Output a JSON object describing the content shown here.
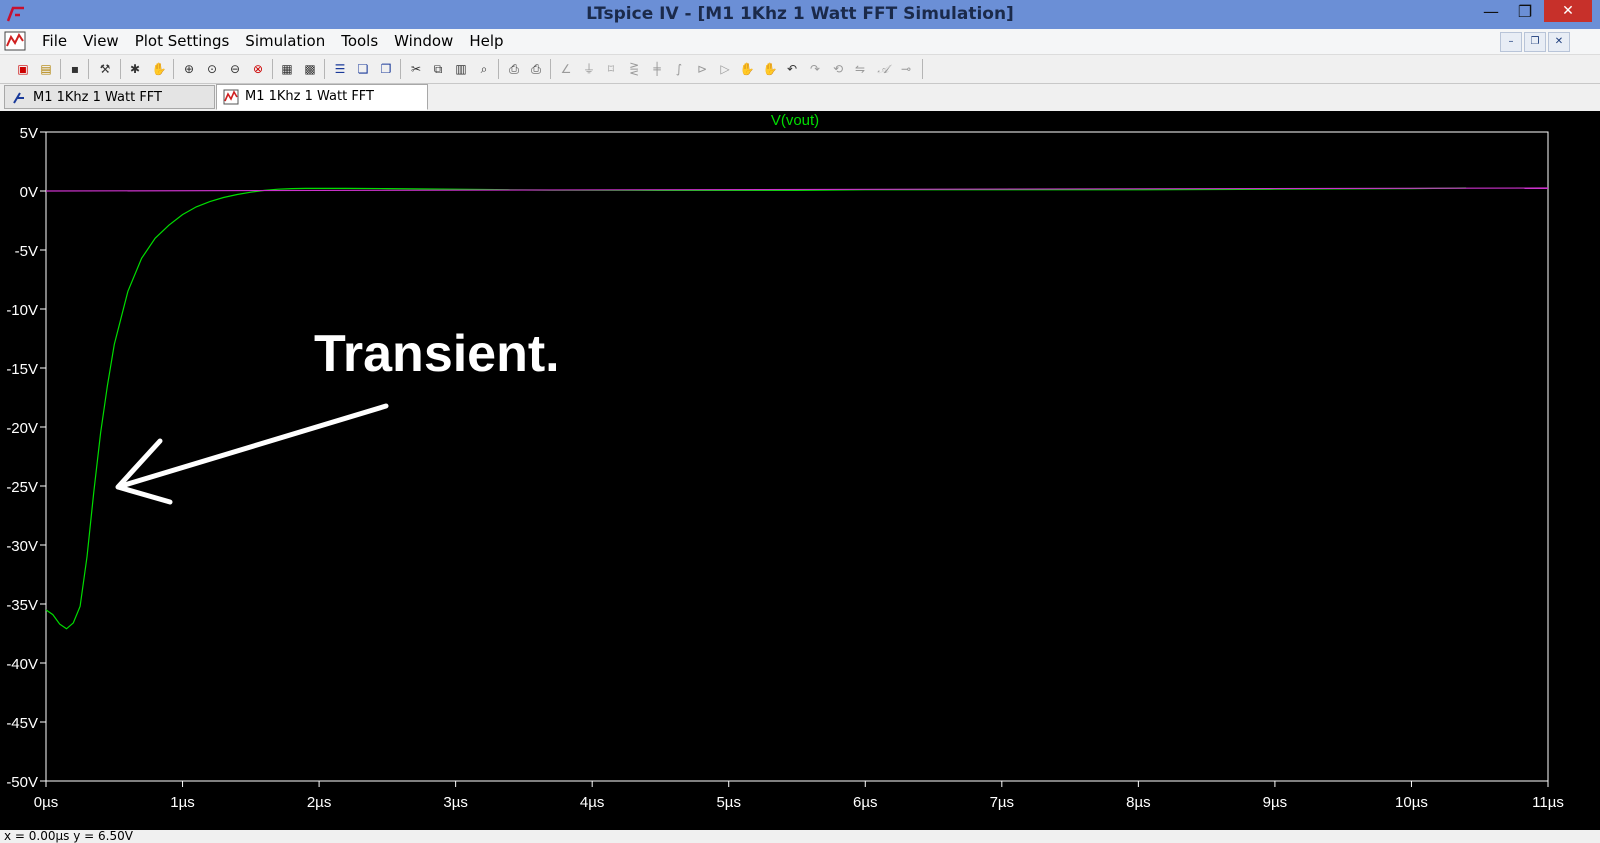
{
  "window": {
    "title": "LTspice IV - [M1 1Khz 1 Watt FFT Simulation]",
    "minimize_glyph": "—",
    "maximize_glyph": "❐",
    "close_glyph": "✕"
  },
  "menu": [
    "File",
    "View",
    "Plot Settings",
    "Simulation",
    "Tools",
    "Window",
    "Help"
  ],
  "mdi_controls": [
    "–",
    "❐",
    "✕"
  ],
  "toolbar_icons": [
    "new-schematic-icon",
    "open-icon",
    "save-icon",
    "control-panel-icon",
    "run-icon",
    "halt-icon",
    "zoom-in-icon",
    "zoom-area-icon",
    "zoom-out-icon",
    "zoom-cancel-icon",
    "autorange-icon",
    "fit-icon",
    "tile-horizontal-icon",
    "cascade-icon",
    "tile-vertical-icon",
    "cut-icon",
    "copy-icon",
    "paste-icon",
    "find-icon",
    "print-setup-icon",
    "print-icon",
    "wire-icon",
    "ground-icon",
    "label-icon",
    "resistor-icon",
    "capacitor-icon",
    "inductor-icon",
    "diode-icon",
    "component-icon",
    "move-icon",
    "drag-icon",
    "undo-icon",
    "redo-icon",
    "rotate-icon",
    "mirror-icon",
    "text-icon",
    "spice-directive-icon"
  ],
  "tabs": [
    {
      "label": "M1 1Khz 1 Watt FFT Simulation",
      "icon": "schematic-icon",
      "active": false
    },
    {
      "label": "M1 1Khz 1 Watt FFT Simulation",
      "icon": "waveform-icon",
      "active": true
    }
  ],
  "chart_data": {
    "type": "line",
    "title": "V(vout)",
    "xlabel": "",
    "ylabel": "",
    "xlim": [
      0,
      11
    ],
    "ylim": [
      -50,
      5
    ],
    "x_ticks": [
      "0µs",
      "1µs",
      "2µs",
      "3µs",
      "4µs",
      "5µs",
      "6µs",
      "7µs",
      "8µs",
      "9µs",
      "10µs",
      "11µs"
    ],
    "y_ticks": [
      "5V",
      "0V",
      "-5V",
      "-10V",
      "-15V",
      "-20V",
      "-25V",
      "-30V",
      "-35V",
      "-40V",
      "-45V",
      "-50V"
    ],
    "x_tick_values": [
      0,
      1,
      2,
      3,
      4,
      5,
      6,
      7,
      8,
      9,
      10,
      11
    ],
    "y_tick_values": [
      5,
      0,
      -5,
      -10,
      -15,
      -20,
      -25,
      -30,
      -35,
      -40,
      -45,
      -50
    ],
    "series": [
      {
        "name": "V(vout)",
        "color": "#00dd00",
        "x": [
          0.0,
          0.05,
          0.1,
          0.15,
          0.2,
          0.25,
          0.3,
          0.35,
          0.4,
          0.45,
          0.5,
          0.6,
          0.7,
          0.8,
          0.9,
          1.0,
          1.1,
          1.2,
          1.3,
          1.4,
          1.5,
          1.6,
          1.7,
          1.8,
          1.9,
          2.0,
          2.2,
          2.5,
          3.0,
          3.4,
          3.7,
          4.5,
          5.5,
          6.0,
          7.0,
          8.0,
          9.0,
          10.0,
          10.4
        ],
        "y": [
          -35.5,
          -35.9,
          -36.7,
          -37.1,
          -36.6,
          -35.2,
          -31.0,
          -25.5,
          -20.5,
          -16.5,
          -13.0,
          -8.5,
          -5.7,
          -4.0,
          -2.9,
          -2.0,
          -1.35,
          -0.9,
          -0.55,
          -0.3,
          -0.1,
          0.05,
          0.15,
          0.2,
          0.22,
          0.22,
          0.22,
          0.2,
          0.15,
          0.1,
          0.08,
          0.05,
          0.05,
          0.1,
          0.1,
          0.1,
          0.15,
          0.2,
          0.25
        ]
      },
      {
        "name": "",
        "color": "#cc33cc",
        "x": [
          0,
          11
        ],
        "y": [
          0.0,
          0.25
        ]
      }
    ],
    "grid": false,
    "legend": "top-center",
    "annotation": {
      "text": "Transient.",
      "color": "#ffffff"
    }
  },
  "status": {
    "text": "x = 0.00µs    y = 6.50V"
  }
}
